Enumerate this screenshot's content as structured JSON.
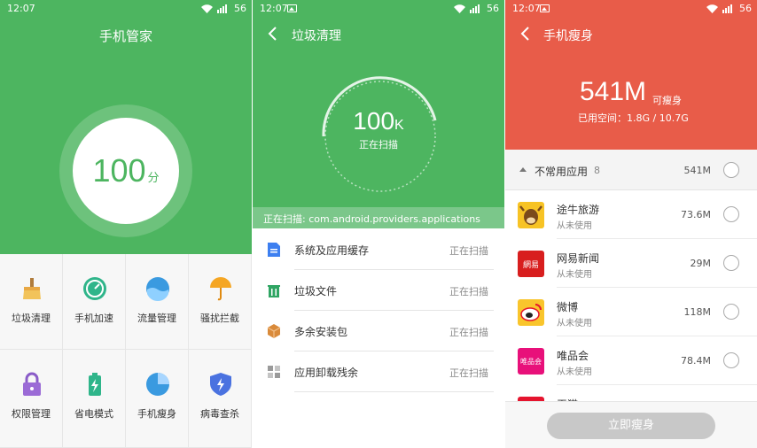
{
  "colors": {
    "green": "#4db560",
    "red": "#e85c49",
    "disabled_button": "#c8c8c8"
  },
  "statusbar": {
    "time": "12:07",
    "battery": "56"
  },
  "screen1": {
    "title": "手机管家",
    "score": "100",
    "score_unit": "分",
    "tools": [
      {
        "label": "垃圾清理",
        "icon": "broom-icon"
      },
      {
        "label": "手机加速",
        "icon": "speedometer-icon"
      },
      {
        "label": "流量管理",
        "icon": "data-traffic-icon"
      },
      {
        "label": "骚扰拦截",
        "icon": "umbrella-icon"
      },
      {
        "label": "权限管理",
        "icon": "lock-icon"
      },
      {
        "label": "省电模式",
        "icon": "battery-icon"
      },
      {
        "label": "手机瘦身",
        "icon": "pie-chart-icon"
      },
      {
        "label": "病毒查杀",
        "icon": "shield-icon"
      }
    ]
  },
  "screen2": {
    "title": "垃圾清理",
    "amount": "100",
    "amount_unit": "K",
    "status": "正在扫描",
    "scan_path": "正在扫描: com.android.providers.applications",
    "items": [
      {
        "label": "系统及应用缓存",
        "status": "正在扫描",
        "icon": "document-icon"
      },
      {
        "label": "垃圾文件",
        "status": "正在扫描",
        "icon": "trash-icon"
      },
      {
        "label": "多余安装包",
        "status": "正在扫描",
        "icon": "package-icon"
      },
      {
        "label": "应用卸载残余",
        "status": "正在扫描",
        "icon": "residue-icon"
      }
    ]
  },
  "screen3": {
    "title": "手机瘦身",
    "size": "541M",
    "size_note": "可瘦身",
    "used_space": "已用空间：1.8G / 10.7G",
    "section": {
      "name": "不常用应用",
      "count": "8",
      "size": "541M"
    },
    "apps": [
      {
        "name": "途牛旅游",
        "usage": "从未使用",
        "size": "73.6M",
        "icon": "tuniu-logo-icon"
      },
      {
        "name": "网易新闻",
        "usage": "从未使用",
        "size": "29M",
        "icon": "netease-news-logo-icon"
      },
      {
        "name": "微博",
        "usage": "从未使用",
        "size": "118M",
        "icon": "weibo-logo-icon"
      },
      {
        "name": "唯品会",
        "usage": "从未使用",
        "size": "78.4M",
        "icon": "vip-logo-icon"
      },
      {
        "name": "天猫",
        "usage": "",
        "size": "",
        "icon": "tmall-logo-icon"
      }
    ],
    "button": "立即瘦身",
    "logo_text": {
      "netease": "網易",
      "vip": "唯品会"
    }
  }
}
